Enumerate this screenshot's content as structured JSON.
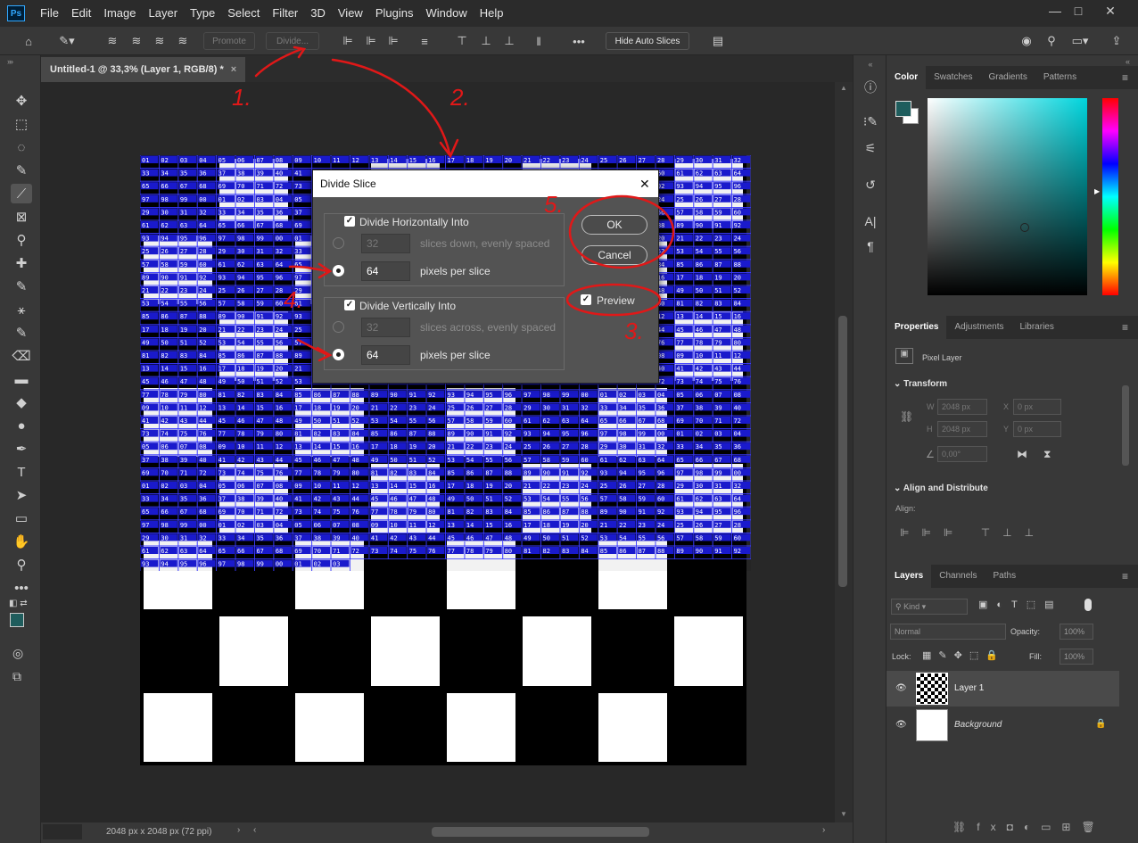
{
  "menubar": {
    "logo": "Ps",
    "items": [
      "File",
      "Edit",
      "Image",
      "Layer",
      "Type",
      "Select",
      "Filter",
      "3D",
      "View",
      "Plugins",
      "Window",
      "Help"
    ],
    "window_buttons": [
      "—",
      "□",
      "✕"
    ]
  },
  "options_bar": {
    "promote_label": "Promote",
    "divide_label": "Divide...",
    "more_label": "•••",
    "hide_auto_slices_label": "Hide Auto Slices"
  },
  "document": {
    "tab_title": "Untitled-1 @ 33,3% (Layer 1, RGB/8) *",
    "close_glyph": "×",
    "status_text": "2048 px x 2048 px (72 ppi)"
  },
  "dialog": {
    "title": "Divide Slice",
    "close_glyph": "✕",
    "horizontal": {
      "label": "Divide Horizontally Into",
      "checked": true,
      "slices_value": "32",
      "slices_label": "slices down, evenly spaced",
      "pixels_value": "64",
      "pixels_label": "pixels per slice"
    },
    "vertical": {
      "label": "Divide Vertically Into",
      "checked": true,
      "slices_value": "32",
      "slices_label": "slices across, evenly spaced",
      "pixels_value": "64",
      "pixels_label": "pixels per slice"
    },
    "ok_label": "OK",
    "cancel_label": "Cancel",
    "preview_label": "Preview",
    "preview_checked": true
  },
  "annotations": [
    "1.",
    "2.",
    "3.",
    "4.",
    "5."
  ],
  "color_panel": {
    "tabs": [
      "Color",
      "Swatches",
      "Gradients",
      "Patterns"
    ],
    "active_tab": "Color",
    "foreground_color": "#1f5d5d",
    "background_color": "#ffffff",
    "hue_color": "#00d5dd"
  },
  "properties_panel": {
    "tabs": [
      "Properties",
      "Adjustments",
      "Libraries"
    ],
    "active_tab": "Properties",
    "layer_type": "Pixel Layer",
    "transform_title": "Transform",
    "w_label": "W",
    "w_value": "2048 px",
    "h_label": "H",
    "h_value": "2048 px",
    "x_label": "X",
    "x_value": "0 px",
    "y_label": "Y",
    "y_value": "0 px",
    "angle_value": "0,00°",
    "align_title": "Align and Distribute",
    "align_label": "Align:"
  },
  "layers_panel": {
    "tabs": [
      "Layers",
      "Channels",
      "Paths"
    ],
    "active_tab": "Layers",
    "kind_placeholder": "Kind",
    "blend_mode": "Normal",
    "opacity_label": "Opacity:",
    "opacity_value": "100%",
    "lock_label": "Lock:",
    "fill_label": "Fill:",
    "fill_value": "100%",
    "layers": [
      {
        "name": "Layer 1",
        "selected": true,
        "visible": true
      },
      {
        "name": "Background",
        "selected": false,
        "visible": true,
        "locked": true
      }
    ],
    "footer_icons": [
      "link-icon",
      "fx-icon",
      "mask-icon",
      "adjustment-icon",
      "folder-icon",
      "new-layer-icon",
      "trash-icon"
    ],
    "fx_label": "fx"
  },
  "tools": [
    "move-tool",
    "marquee-tool",
    "lasso-tool",
    "quick-select-tool",
    "slice-tool",
    "frame-tool",
    "eyedropper-tool",
    "healing-tool",
    "brush-tool",
    "stamp-tool",
    "history-brush-tool",
    "eraser-tool",
    "gradient-tool",
    "blur-tool",
    "dodge-tool",
    "pen-tool",
    "type-tool",
    "path-select-tool",
    "shape-tool",
    "hand-tool",
    "zoom-tool",
    "more-tools"
  ]
}
